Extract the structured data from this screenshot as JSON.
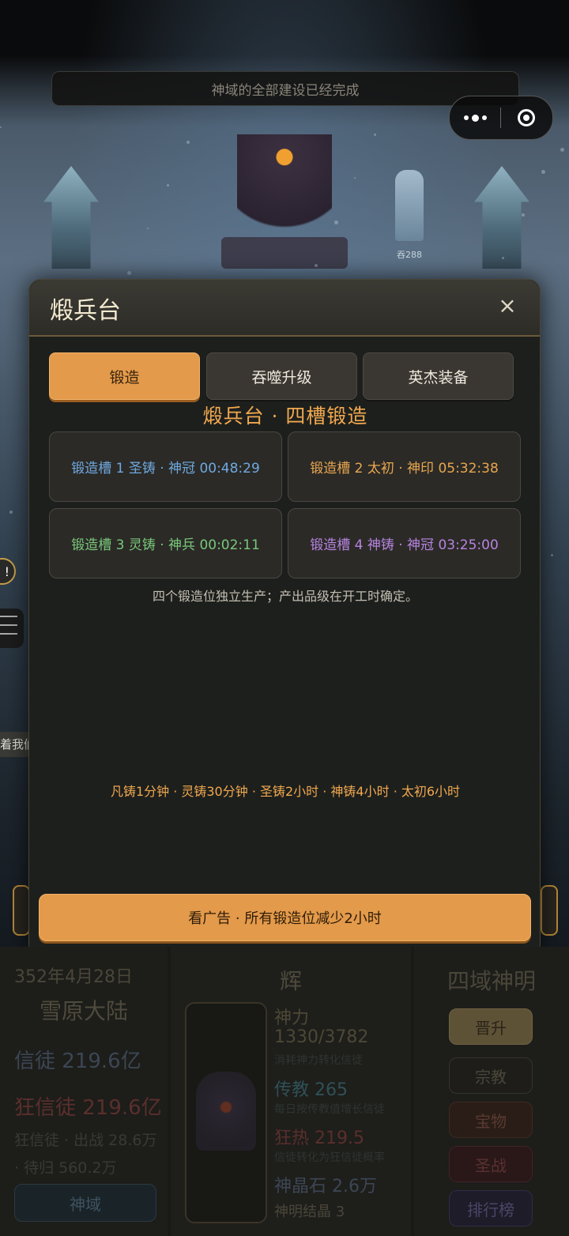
{
  "top_banner": "神域的全部建设已经完成",
  "scene": {
    "npc_label": "吞288"
  },
  "side": {
    "bubble": "!",
    "chip": "着我们"
  },
  "modal": {
    "title": "煅兵台",
    "close": "×",
    "tabs": [
      {
        "label": "锻造",
        "active": true
      },
      {
        "label": "吞噬升级",
        "active": false
      },
      {
        "label": "英杰装备",
        "active": false
      }
    ],
    "forge_title": "煅兵台 · 四槽锻造",
    "slots": [
      {
        "text": "锻造槽 1 圣铸 · 神冠 00:48:29",
        "color": "#6fa9e0"
      },
      {
        "text": "锻造槽 2 太初 · 神印 05:32:38",
        "color": "#e8a64f"
      },
      {
        "text": "锻造槽 3 灵铸 · 神兵 00:02:11",
        "color": "#79c87a"
      },
      {
        "text": "锻造槽 4 神铸 · 神冠 03:25:00",
        "color": "#b784e0"
      }
    ],
    "note": "四个锻造位独立生产；产出品级在开工时确定。",
    "times": "凡铸1分钟 · 灵铸30分钟 · 圣铸2小时 · 神铸4小时 · 太初6小时",
    "ad_button": "看广告 · 所有锻造位减少2小时"
  },
  "dashboard": {
    "left": {
      "date": "352年4月28日",
      "region": "雪原大陆",
      "believers": "信徒 219.6亿",
      "zealots": "狂信徒 219.6亿",
      "detail": "狂信徒 · 出战 28.6万 · 待归 560.2万",
      "domain_button": "神域"
    },
    "middle": {
      "name": "辉",
      "stats": [
        {
          "label": "神力",
          "color": "#4d4836"
        },
        {
          "label": "1330/3782",
          "color": "#4d4836"
        },
        {
          "label": "消耗神力转化信徒",
          "sub": true
        },
        {
          "label": "传教 265",
          "color": "#2f5157"
        },
        {
          "label": "每日按传教值增长信徒",
          "sub": true
        },
        {
          "label": "狂热 219.5",
          "color": "#5a2f2c"
        },
        {
          "label": "信徒转化为狂信徒概率",
          "sub": true
        },
        {
          "label": "神晶石 2.6万",
          "color": "#3c4654"
        },
        {
          "label": "神明结晶 3",
          "color": "#4a4639"
        }
      ]
    },
    "right": {
      "title": "四域神明",
      "buttons": [
        {
          "label": "晋升",
          "bg": "#5e5236",
          "border": "#6f6243",
          "color": "#2a2418"
        },
        {
          "label": "宗教",
          "bg": "#1e1d1a",
          "border": "#35332d",
          "color": "#4a4639"
        },
        {
          "label": "宝物",
          "bg": "#2a1d18",
          "border": "#3d2a22",
          "color": "#5a3a30"
        },
        {
          "label": "圣战",
          "bg": "#2a1818",
          "border": "#3d2424",
          "color": "#5a3030"
        },
        {
          "label": "排行榜",
          "bg": "#1f1c2a",
          "border": "#312c44",
          "color": "#4b4566"
        }
      ]
    }
  }
}
